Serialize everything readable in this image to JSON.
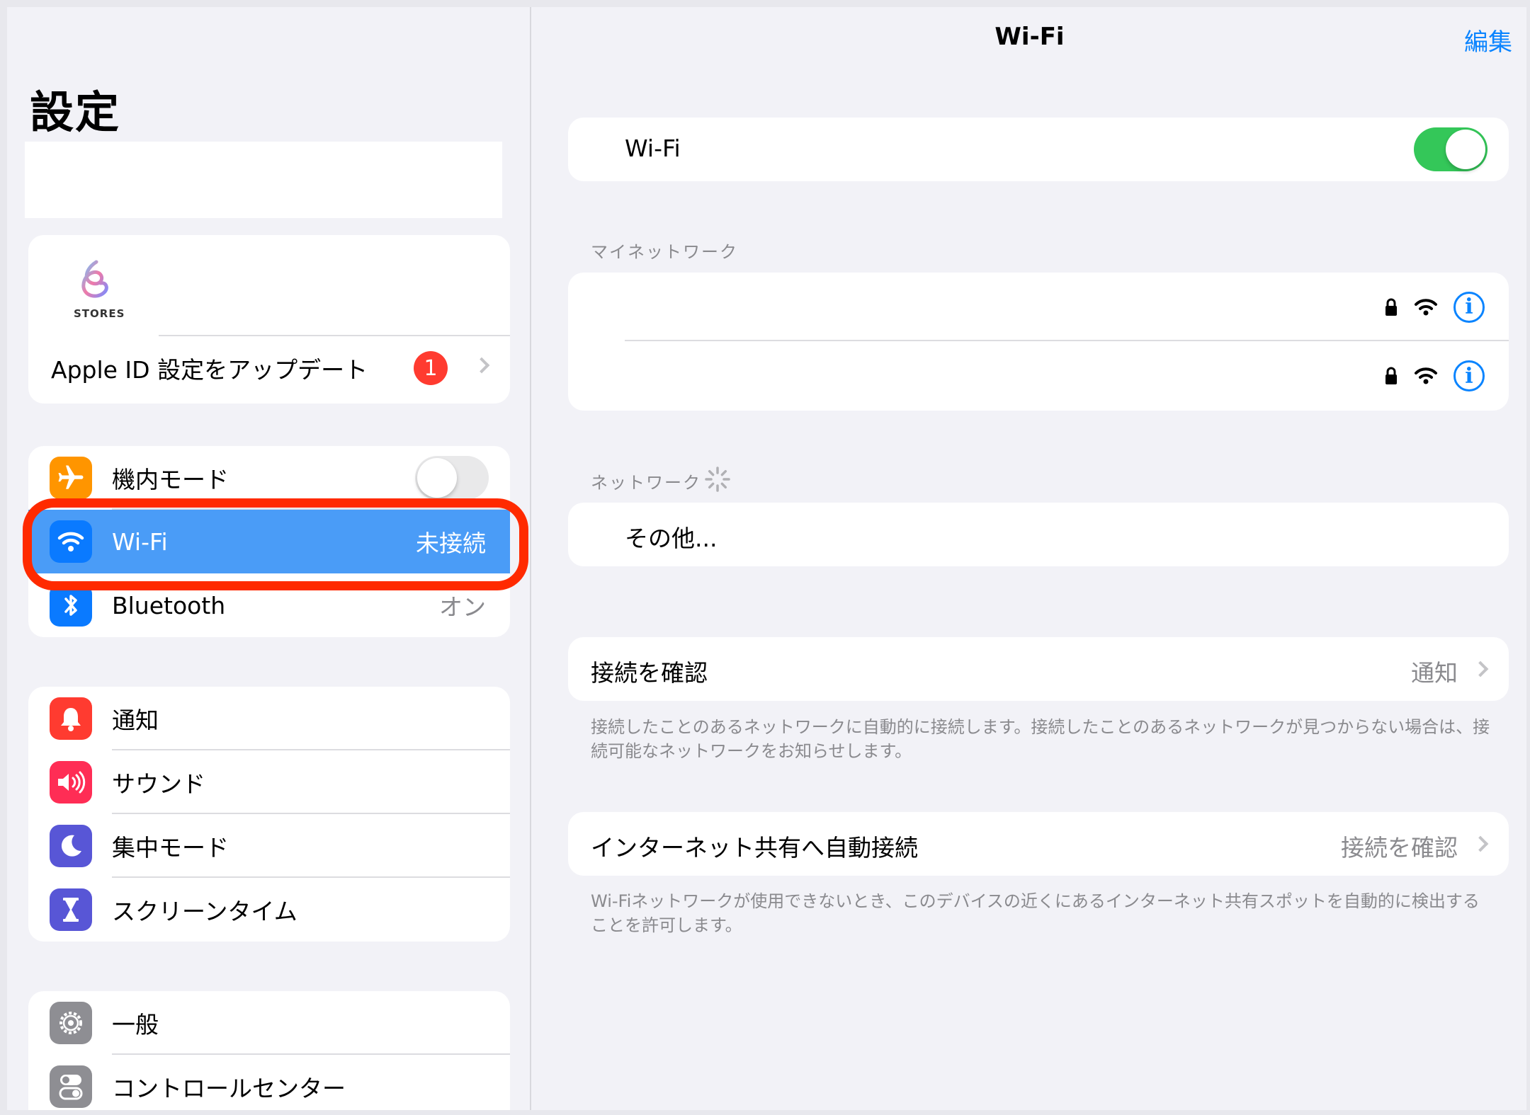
{
  "colors": {
    "accent": "#0a84ff",
    "toggle_on": "#34c759",
    "toggle_off": "#e9e9ea",
    "highlight_row": "#4a9cf7",
    "annotation_outline": "#ff2a00",
    "badge": "#ff3b30"
  },
  "sidebar": {
    "title": "設定",
    "profile": {
      "logo_text": "STORES",
      "update_label": "Apple ID 設定をアップデート",
      "badge_count": "1"
    },
    "connectivity": [
      {
        "label": "機内モード",
        "icon": "airplane-icon",
        "icon_color": "#ff9500",
        "toggle_on": false
      },
      {
        "label": "Wi-Fi",
        "icon": "wifi-icon",
        "icon_color": "#0a7aff",
        "value": "未接続",
        "selected": true
      },
      {
        "label": "Bluetooth",
        "icon": "bluetooth-icon",
        "icon_color": "#0a7aff",
        "value": "オン"
      }
    ],
    "notifications_group": [
      {
        "label": "通知",
        "icon": "bell-icon",
        "icon_color": "#ff3b30"
      },
      {
        "label": "サウンド",
        "icon": "speaker-icon",
        "icon_color": "#ff2d55"
      },
      {
        "label": "集中モード",
        "icon": "moon-icon",
        "icon_color": "#5856d6"
      },
      {
        "label": "スクリーンタイム",
        "icon": "hourglass-icon",
        "icon_color": "#5856d6"
      }
    ],
    "general_group": [
      {
        "label": "一般",
        "icon": "gear-icon",
        "icon_color": "#8e8e93"
      },
      {
        "label": "コントロールセンター",
        "icon": "switches-icon",
        "icon_color": "#8e8e93"
      }
    ]
  },
  "main": {
    "title": "Wi-Fi",
    "edit_label": "編集",
    "wifi_toggle": {
      "label": "Wi-Fi",
      "on": true
    },
    "my_networks_header": "マイネットワーク",
    "my_networks": [
      {
        "name": "",
        "icons": [
          "lock-icon",
          "wifi-signal-icon",
          "info-icon"
        ]
      },
      {
        "name": "",
        "icons": [
          "lock-icon",
          "wifi-signal-icon",
          "info-icon"
        ]
      }
    ],
    "networks_header": "ネットワーク",
    "other_label": "その他...",
    "ask_to_join": {
      "label": "接続を確認",
      "value": "通知",
      "footnote": "接続したことのあるネットワークに自動的に接続します。接続したことのあるネットワークが見つからない場合は、接続可能なネットワークをお知らせします。"
    },
    "auto_hotspot": {
      "label": "インターネット共有へ自動接続",
      "value": "接続を確認",
      "footnote": "Wi-Fiネットワークが使用できないとき、このデバイスの近くにあるインターネット共有スポットを自動的に検出することを許可します。"
    }
  }
}
